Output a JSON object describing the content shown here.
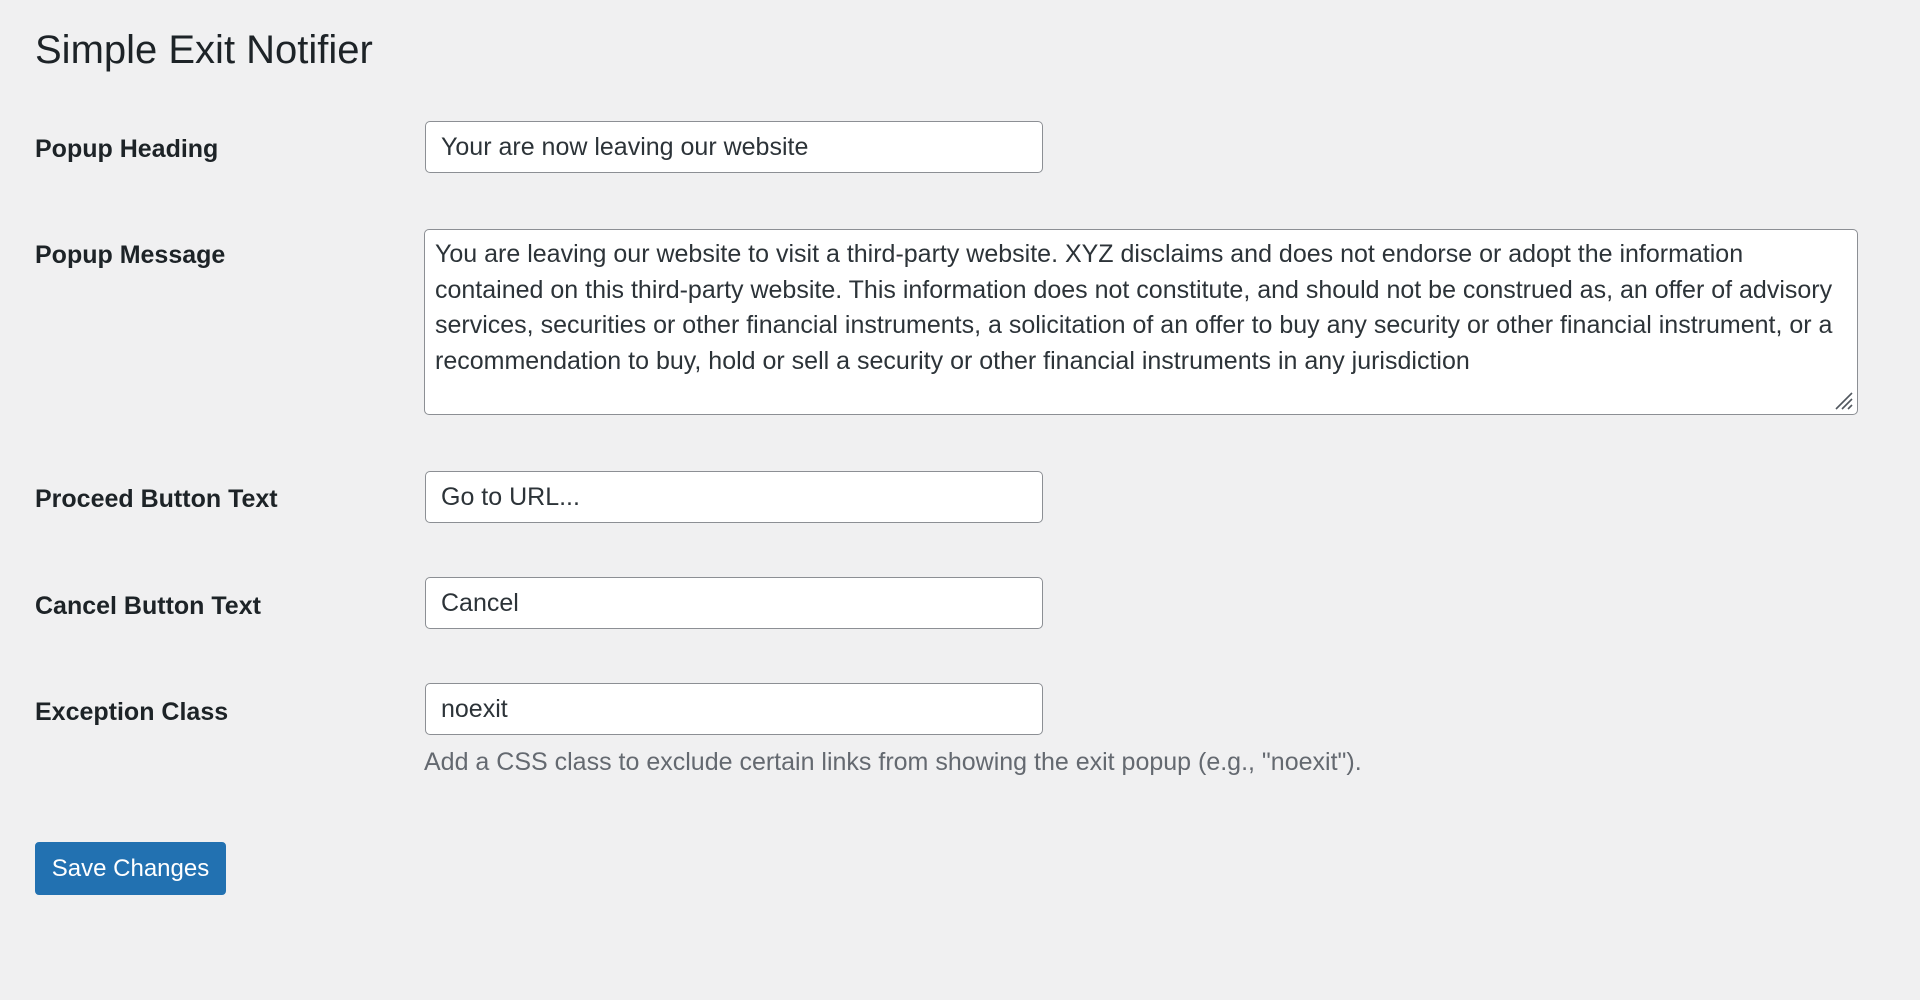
{
  "page": {
    "title": "Simple Exit Notifier"
  },
  "fields": {
    "popup_heading": {
      "label": "Popup Heading",
      "value": "Your are now leaving our website"
    },
    "popup_message": {
      "label": "Popup Message",
      "value": "You are leaving our website to visit a third-party website. XYZ disclaims and does not endorse or adopt the information contained on this third-party website. This information does not constitute, and should not be construed as, an offer of advisory services, securities or other financial instruments, a solicitation of an offer to buy any security or other financial instrument, or a recommendation to buy, hold or sell a security or other financial instruments in any jurisdiction"
    },
    "proceed_button_text": {
      "label": "Proceed Button Text",
      "value": "Go to URL..."
    },
    "cancel_button_text": {
      "label": "Cancel Button Text",
      "value": "Cancel"
    },
    "exception_class": {
      "label": "Exception Class",
      "value": "noexit",
      "description": "Add a CSS class to exclude certain links from showing the exit popup (e.g., \"noexit\")."
    }
  },
  "actions": {
    "save_label": "Save Changes"
  },
  "colors": {
    "background": "#f0f0f1",
    "primary": "#2271b1",
    "input_border": "#8c8f94",
    "description_text": "#646970"
  },
  "icons": {
    "resize_grip": "resize-grip-icon"
  }
}
